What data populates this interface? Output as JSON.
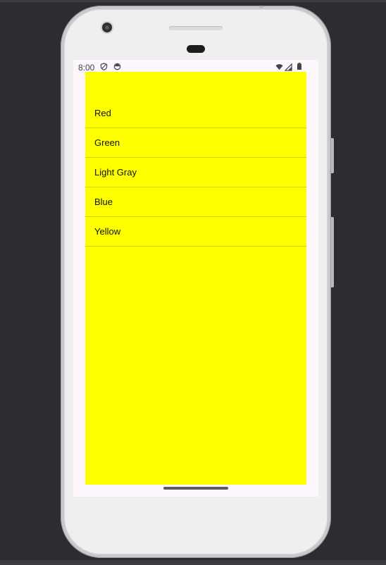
{
  "status_bar": {
    "time": "8:00",
    "left_icons": [
      "shield-icon",
      "circle-icon"
    ],
    "right_icons": [
      "wifi-icon",
      "signal-icon",
      "battery-icon"
    ]
  },
  "app": {
    "background_color": "#ffff00",
    "list": {
      "items": [
        {
          "label": "Red"
        },
        {
          "label": "Green"
        },
        {
          "label": "Light Gray"
        },
        {
          "label": "Blue"
        },
        {
          "label": "Yellow"
        }
      ]
    }
  }
}
